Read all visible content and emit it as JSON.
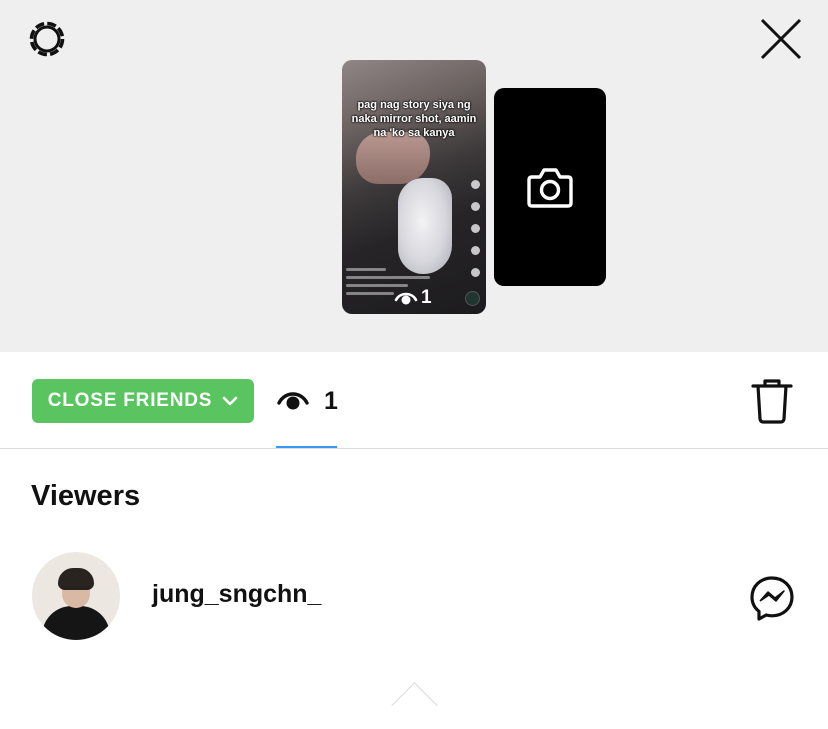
{
  "header": {
    "settings_icon": "gear-icon",
    "close_icon": "close-icon"
  },
  "story": {
    "caption": "pag nag story siya ng naka mirror shot, aamin na 'ko sa kanya",
    "view_count": "1",
    "add_icon": "camera-icon"
  },
  "toolbar": {
    "audience_label": "CLOSE FRIENDS",
    "audience_color": "#5ac560",
    "view_count": "1",
    "active_tab_color": "#3897f0",
    "delete_icon": "trash-icon"
  },
  "viewers": {
    "title": "Viewers",
    "items": [
      {
        "username": "jung_sngchn_",
        "action_icon": "messenger-icon"
      }
    ]
  }
}
